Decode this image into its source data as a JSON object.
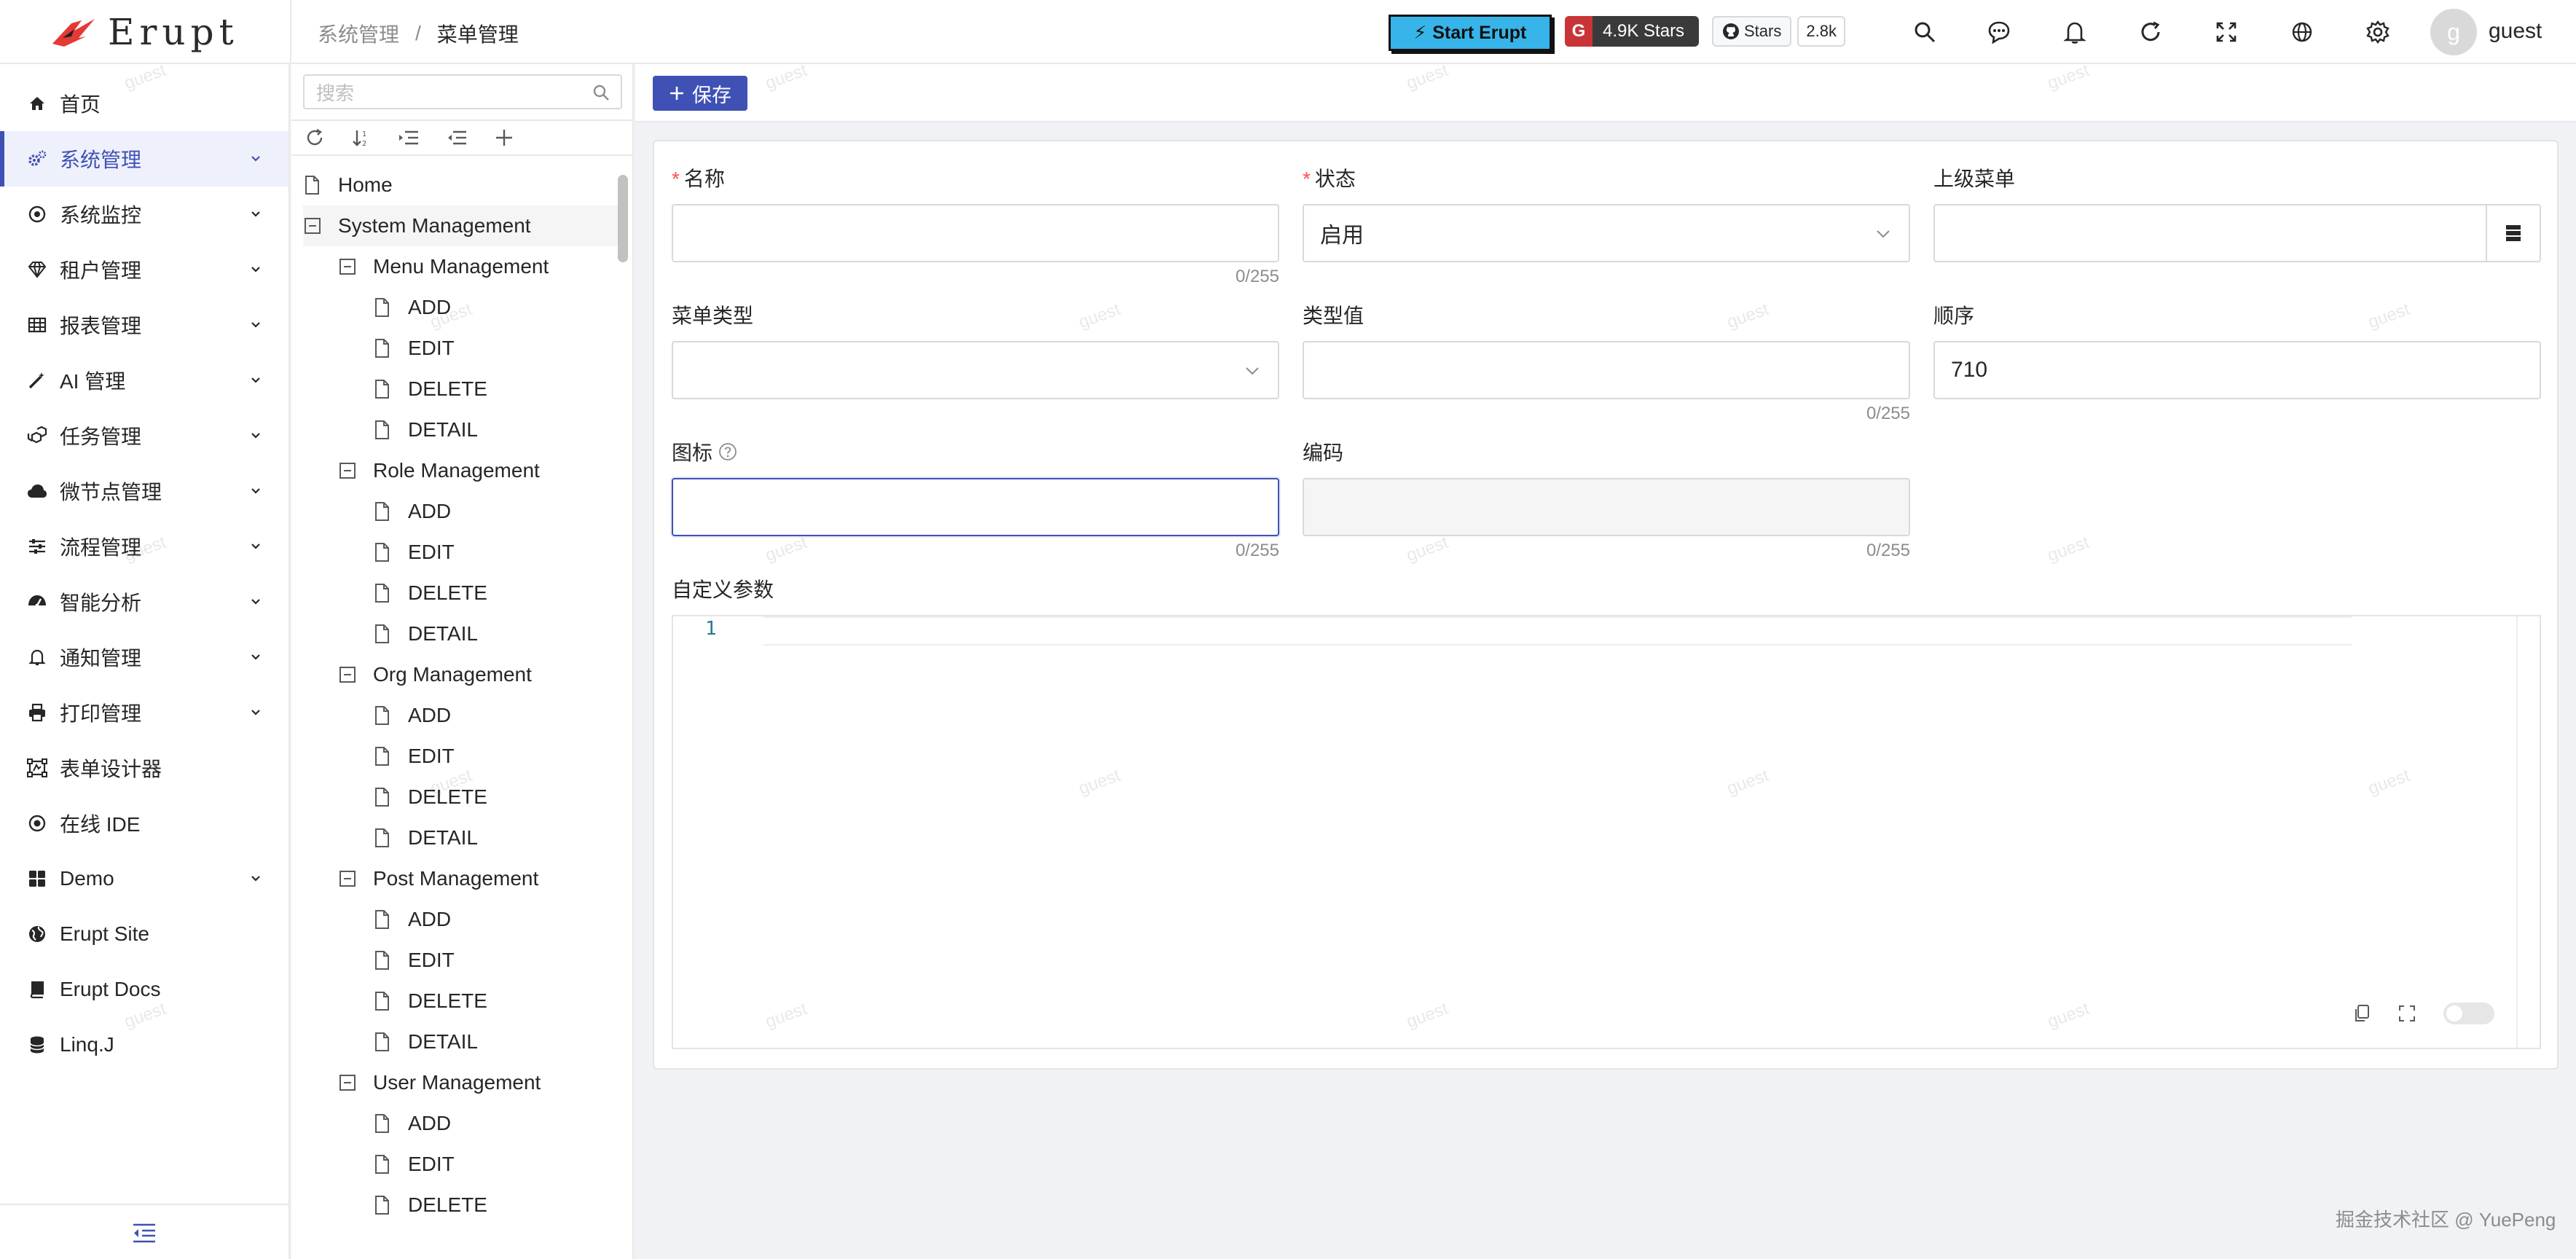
{
  "header": {
    "logo_text": "Erupt",
    "breadcrumb": [
      "系统管理",
      "/",
      "菜单管理"
    ],
    "start_button": "Start Erupt",
    "stars_badge": "4.9K Stars",
    "github_stars_label": "Stars",
    "github_stars_count": "2.8k",
    "username": "guest",
    "avatar_letter": "g",
    "icons": [
      "search-icon",
      "chat-icon",
      "bell-icon",
      "reload-icon",
      "fullscreen-icon",
      "globe-icon",
      "settings-icon"
    ]
  },
  "sidebar": {
    "items": [
      {
        "label": "首页",
        "icon": "home-icon",
        "chevron": false,
        "active": false
      },
      {
        "label": "系统管理",
        "icon": "cogs-icon",
        "chevron": true,
        "active": true
      },
      {
        "label": "系统监控",
        "icon": "monitor-icon",
        "chevron": true,
        "active": false
      },
      {
        "label": "租户管理",
        "icon": "diamond-icon",
        "chevron": true,
        "active": false
      },
      {
        "label": "报表管理",
        "icon": "table-icon",
        "chevron": true,
        "active": false
      },
      {
        "label": "AI 管理",
        "icon": "wand-icon",
        "chevron": true,
        "active": false
      },
      {
        "label": "任务管理",
        "icon": "cubes-icon",
        "chevron": true,
        "active": false
      },
      {
        "label": "微节点管理",
        "icon": "cloud-icon",
        "chevron": true,
        "active": false
      },
      {
        "label": "流程管理",
        "icon": "sliders-icon",
        "chevron": true,
        "active": false
      },
      {
        "label": "智能分析",
        "icon": "dashboard-icon",
        "chevron": true,
        "active": false
      },
      {
        "label": "通知管理",
        "icon": "bell-icon",
        "chevron": true,
        "active": false
      },
      {
        "label": "打印管理",
        "icon": "printer-icon",
        "chevron": true,
        "active": false
      },
      {
        "label": "表单设计器",
        "icon": "form-design-icon",
        "chevron": false,
        "active": false
      },
      {
        "label": "在线 IDE",
        "icon": "code-icon",
        "chevron": false,
        "active": false
      },
      {
        "label": "Demo",
        "icon": "grid-icon",
        "chevron": true,
        "active": false
      },
      {
        "label": "Erupt Site",
        "icon": "globe-icon",
        "chevron": false,
        "active": false
      },
      {
        "label": "Erupt Docs",
        "icon": "book-icon",
        "chevron": false,
        "active": false
      },
      {
        "label": "Linq.J",
        "icon": "database-icon",
        "chevron": false,
        "active": false
      }
    ]
  },
  "tree": {
    "search_placeholder": "搜索",
    "toolbar_icons": [
      "refresh-icon",
      "sort-icon",
      "expand-all-icon",
      "collapse-all-icon",
      "add-icon"
    ],
    "nodes": [
      {
        "label": "Home",
        "level": 0,
        "type": "file"
      },
      {
        "label": "System Management",
        "level": 0,
        "type": "folder"
      },
      {
        "label": "Menu Management",
        "level": 1,
        "type": "folder"
      },
      {
        "label": "ADD",
        "level": 2,
        "type": "file"
      },
      {
        "label": "EDIT",
        "level": 2,
        "type": "file"
      },
      {
        "label": "DELETE",
        "level": 2,
        "type": "file"
      },
      {
        "label": "DETAIL",
        "level": 2,
        "type": "file"
      },
      {
        "label": "Role Management",
        "level": 1,
        "type": "folder"
      },
      {
        "label": "ADD",
        "level": 2,
        "type": "file"
      },
      {
        "label": "EDIT",
        "level": 2,
        "type": "file"
      },
      {
        "label": "DELETE",
        "level": 2,
        "type": "file"
      },
      {
        "label": "DETAIL",
        "level": 2,
        "type": "file"
      },
      {
        "label": "Org Management",
        "level": 1,
        "type": "folder"
      },
      {
        "label": "ADD",
        "level": 2,
        "type": "file"
      },
      {
        "label": "EDIT",
        "level": 2,
        "type": "file"
      },
      {
        "label": "DELETE",
        "level": 2,
        "type": "file"
      },
      {
        "label": "DETAIL",
        "level": 2,
        "type": "file"
      },
      {
        "label": "Post Management",
        "level": 1,
        "type": "folder"
      },
      {
        "label": "ADD",
        "level": 2,
        "type": "file"
      },
      {
        "label": "EDIT",
        "level": 2,
        "type": "file"
      },
      {
        "label": "DELETE",
        "level": 2,
        "type": "file"
      },
      {
        "label": "DETAIL",
        "level": 2,
        "type": "file"
      },
      {
        "label": "User Management",
        "level": 1,
        "type": "folder"
      },
      {
        "label": "ADD",
        "level": 2,
        "type": "file"
      },
      {
        "label": "EDIT",
        "level": 2,
        "type": "file"
      },
      {
        "label": "DELETE",
        "level": 2,
        "type": "file"
      }
    ]
  },
  "toolbar": {
    "save_label": "保存"
  },
  "form": {
    "name_label": "名称",
    "name_value": "",
    "name_counter": "0/255",
    "status_label": "状态",
    "status_value": "启用",
    "parent_label": "上级菜单",
    "parent_value": "",
    "type_label": "菜单类型",
    "type_value": "",
    "type_value_label": "类型值",
    "type_value_value": "",
    "type_value_counter": "0/255",
    "order_label": "顺序",
    "order_value": "710",
    "icon_label": "图标",
    "icon_value": "",
    "icon_counter": "0/255",
    "code_label": "编码",
    "code_value": "",
    "code_counter": "0/255",
    "params_label": "自定义参数",
    "editor_line": "1"
  },
  "watermark_text": "guest",
  "footer_credit": "掘金技术社区 @ YuePeng",
  "colors": {
    "primary": "#3f51b5",
    "required": "#ff4d4f",
    "start_button": "#37b4e9"
  }
}
